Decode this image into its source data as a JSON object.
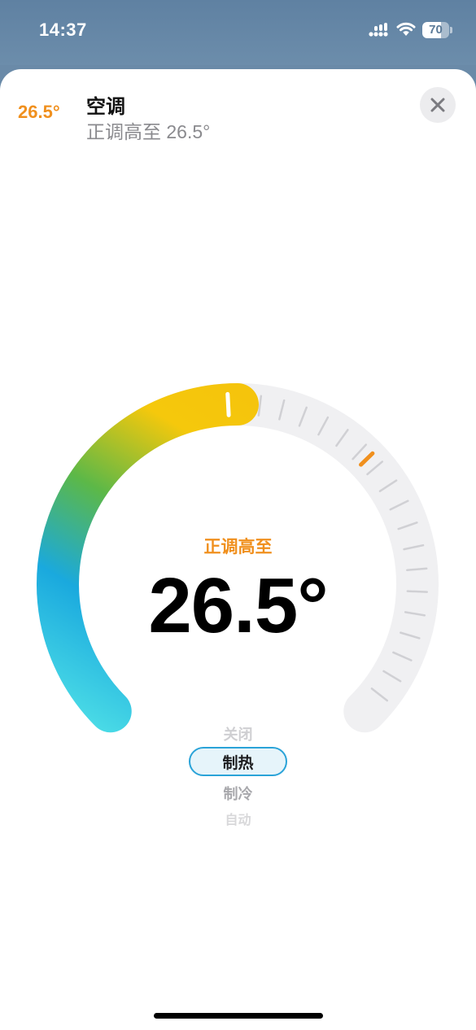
{
  "status_bar": {
    "time": "14:37",
    "battery_percent": 70,
    "battery_text": "70",
    "icons": [
      "signal-icon",
      "wifi-icon",
      "battery-icon"
    ]
  },
  "header": {
    "current_temp": "26.5°",
    "title": "空调",
    "subtitle": "正调高至 26.5°",
    "close_icon": "close-icon"
  },
  "dial": {
    "label": "正调高至",
    "value_text": "26.5°",
    "setpoint_fraction": 0.5,
    "current_marker_fraction": 0.67,
    "colors": {
      "cool_start": "#4adbe6",
      "mid_blue": "#1aa9de",
      "green": "#5cb848",
      "yellow": "#f5c20c",
      "track": "#f0f0f2",
      "tick": "#d0d0d4",
      "current_marker": "#f0901e"
    }
  },
  "mode_picker": {
    "options": [
      "关闭",
      "制热",
      "制冷",
      "自动"
    ],
    "selected": "制热",
    "off_label": "关闭",
    "heat_label": "制热",
    "cool_label": "制冷",
    "auto_label": "自动"
  }
}
